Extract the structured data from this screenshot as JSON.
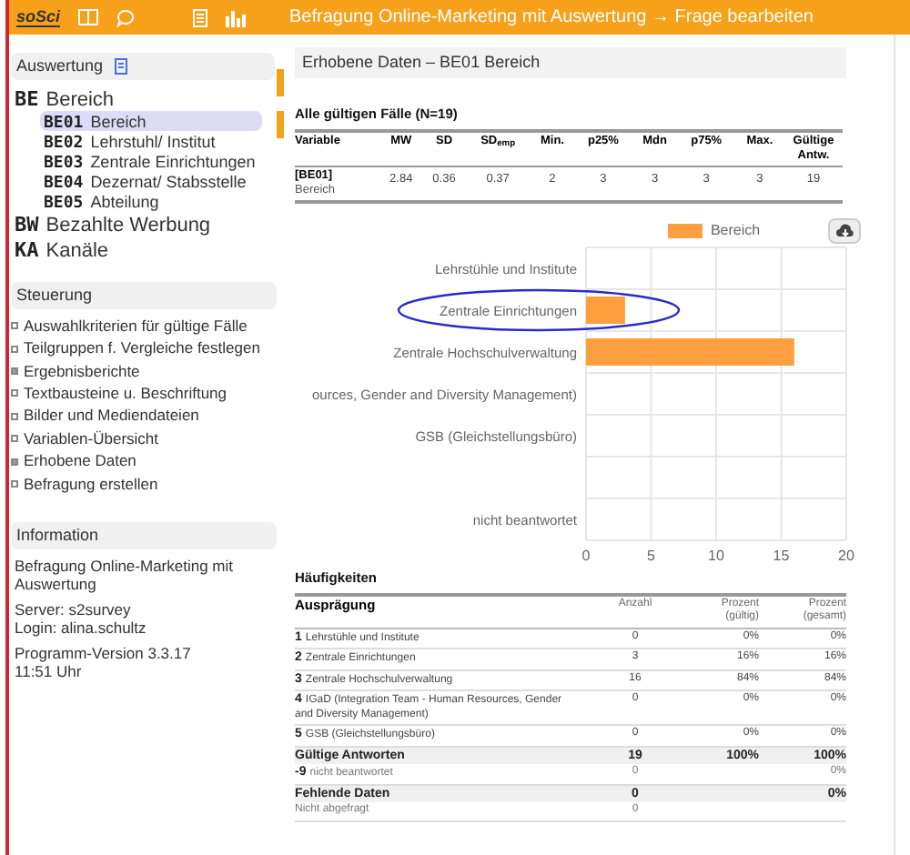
{
  "topbar": {
    "logo": "soSci",
    "title": "Befragung Online-Marketing mit Auswertung → Frage bearbeiten"
  },
  "sidebar": {
    "header": "Auswertung",
    "items": [
      {
        "code": "BE",
        "label": "Bereich",
        "selected": false,
        "children": [
          {
            "code": "BE01",
            "label": "Bereich",
            "selected": true
          },
          {
            "code": "BE02",
            "label": "Lehrstuhl/ Institut",
            "selected": false
          },
          {
            "code": "BE03",
            "label": "Zentrale Einrichtungen",
            "selected": false
          },
          {
            "code": "BE04",
            "label": "Dezernat/ Stabsstelle",
            "selected": false
          },
          {
            "code": "BE05",
            "label": "Abteilung",
            "selected": false
          }
        ]
      },
      {
        "code": "BW",
        "label": "Bezahlte Werbung",
        "selected": false
      },
      {
        "code": "KA",
        "label": "Kanäle",
        "selected": false
      }
    ]
  },
  "control": {
    "header": "Steuerung",
    "items": [
      {
        "label": "Auswahlkriterien für gültige Fälle",
        "active": false
      },
      {
        "label": "Teilgruppen f. Vergleiche festlegen",
        "active": false
      },
      {
        "label": "Ergebnisberichte",
        "active": true
      },
      {
        "label": "Textbausteine u. Beschriftung",
        "active": false
      },
      {
        "label": "Bilder und Mediendateien",
        "active": false
      },
      {
        "label": "Variablen-Übersicht",
        "active": false
      },
      {
        "label": "Erhobene Daten",
        "active": true
      },
      {
        "label": "Befragung erstellen",
        "active": false
      }
    ]
  },
  "information": {
    "header": "Information",
    "lines": [
      "Befragung Online-Marketing mit Auswertung",
      "Server: s2survey\nLogin: alina.schultz",
      "Programm-Version 3.3.17\n11:51 Uhr"
    ]
  },
  "main": {
    "title": "Erhobene Daten – BE01 Bereich",
    "stats_title": "Alle gültigen Fälle (N=19)",
    "stats_columns": [
      "Variable",
      "MW",
      "SD",
      "SD$_{emp}$",
      "Min.",
      "p25%",
      "Mdn",
      "p75%",
      "Max.",
      "Gültige Antw."
    ],
    "stats_row": {
      "variable": "[BE01]",
      "variable_label": "Bereich",
      "values": [
        "2.84",
        "0.36",
        "0.37",
        "2",
        "3",
        "3",
        "3",
        "3",
        "19"
      ]
    },
    "chart_data": {
      "type": "bar",
      "orientation": "horizontal",
      "categories": [
        "Lehrstühle und Institute",
        "Zentrale Einrichtungen",
        "Zentrale Hochschulverwaltung",
        "ources, Gender and Diversity Management)",
        "GSB (Gleichstellungsbüro)",
        null,
        "nicht beantwortet"
      ],
      "series": [
        {
          "name": "Bereich",
          "color": "#ff9f40",
          "values": [
            0,
            3,
            16,
            0,
            0,
            null,
            0
          ]
        }
      ],
      "xlim": [
        0,
        20
      ],
      "xticks": [
        0,
        5,
        10,
        15,
        20
      ],
      "grid": true
    },
    "hand_drawn_mark": {
      "kind": "ellipse",
      "color": "#2a2ac8"
    },
    "freq_title": "Häufigkeiten",
    "freq_columns": [
      "Ausprägung",
      "Anzahl",
      "Prozent\n(gültig)",
      "Prozent\n(gesamt)"
    ],
    "freq_rows": [
      {
        "kind": "value",
        "code": "1",
        "label": "Lehrstühle und Institute",
        "count": "0",
        "pct_valid": "0%",
        "pct_total": "0%"
      },
      {
        "kind": "value",
        "code": "2",
        "label": "Zentrale Einrichtungen",
        "count": "3",
        "pct_valid": "16%",
        "pct_total": "16%"
      },
      {
        "kind": "value",
        "code": "3",
        "label": "Zentrale Hochschulverwaltung",
        "count": "16",
        "pct_valid": "84%",
        "pct_total": "84%"
      },
      {
        "kind": "value",
        "code": "4",
        "label": "IGaD (Integration Team - Human Resources, Gender and Diversity Management)",
        "count": "0",
        "pct_valid": "0%",
        "pct_total": "0%"
      },
      {
        "kind": "value",
        "code": "5",
        "label": "GSB (Gleichstellungsbüro)",
        "count": "0",
        "pct_valid": "0%",
        "pct_total": "0%"
      },
      {
        "kind": "summary",
        "label": "Gültige Antworten",
        "count": "19",
        "pct_valid": "100%",
        "pct_total": "100%"
      },
      {
        "kind": "missing",
        "code": "-9",
        "label": "nicht beantwortet",
        "count": "0",
        "pct_total": "0%"
      },
      {
        "kind": "summary",
        "label": "Fehlende Daten",
        "count": "0",
        "pct_total": "0%"
      },
      {
        "kind": "missing",
        "label": "Nicht abgefragt",
        "count": "0"
      }
    ]
  }
}
